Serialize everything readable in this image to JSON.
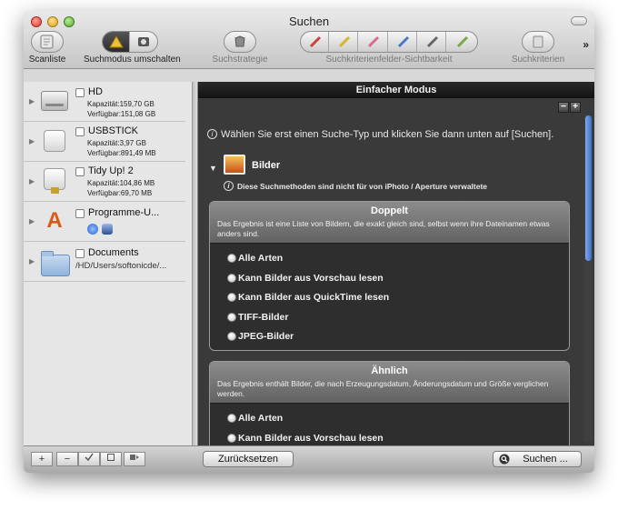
{
  "window": {
    "title": "Suchen"
  },
  "toolbar": {
    "scan_label": "Scanliste",
    "mode_label": "Suchmodus umschalten",
    "strategy_label": "Suchstrategie",
    "visibility_label": "Suchkriterienfelder-Sichtbarkeit",
    "criteria_label": "Suchkriterien",
    "overflow": "»"
  },
  "sidebar": {
    "items": [
      {
        "name": "HD",
        "capacity": "Kapazität:159,70 GB",
        "available": "Verfügbar:151,08 GB"
      },
      {
        "name": "USBSTICK",
        "capacity": "Kapazität:3,97 GB",
        "available": "Verfügbar:891,49 MB"
      },
      {
        "name": "Tidy Up! 2",
        "capacity": "Kapazität:104,86 MB",
        "available": "Verfügbar:69,70 MB"
      },
      {
        "name": "Programme-U..."
      },
      {
        "name": "Documents",
        "path": "/HD/Users/softonicde/..."
      }
    ]
  },
  "main": {
    "header": "Einfacher Modus",
    "minus": "−",
    "plus": "+",
    "info": "Wählen Sie erst einen Suche-Typ und klicken Sie dann unten auf [Suchen].",
    "category": "Bilder",
    "note": "Diese Suchmethoden sind nicht für von iPhoto / Aperture verwaltete",
    "panels": [
      {
        "title": "Doppelt",
        "description": "Das Ergebnis ist eine Liste von Bildern, die exakt gleich sind, selbst wenn ihre Dateinamen etwas anders sind.",
        "options": [
          "Alle Arten",
          "Kann Bilder aus Vorschau lesen",
          "Kann Bilder aus QuickTime lesen",
          "TIFF-Bilder",
          "JPEG-Bilder"
        ]
      },
      {
        "title": "Ähnlich",
        "description": "Das Ergebnis enthält Bilder, die nach Erzeugungsdatum, Änderungsdatum und Größe verglichen werden.",
        "options": [
          "Alle Arten",
          "Kann Bilder aus Vorschau lesen"
        ]
      }
    ]
  },
  "bottombar": {
    "add": "+",
    "remove": "−",
    "reset_label": "Zurücksetzen",
    "search_label": "Suchen ..."
  }
}
